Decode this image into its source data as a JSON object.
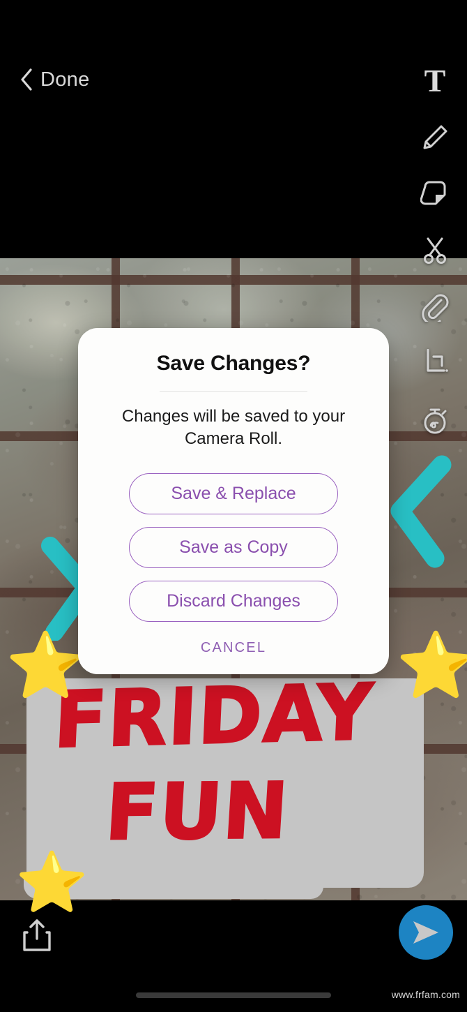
{
  "top_bar": {
    "done_label": "Done",
    "back_icon": "chevron-left-icon"
  },
  "toolbar": {
    "items": [
      {
        "icon": "text-icon",
        "label": "T"
      },
      {
        "icon": "pencil-icon",
        "label": ""
      },
      {
        "icon": "sticker-icon",
        "label": ""
      },
      {
        "icon": "scissors-icon",
        "label": ""
      },
      {
        "icon": "paperclip-icon",
        "label": ""
      },
      {
        "icon": "crop-icon",
        "label": ""
      },
      {
        "icon": "timer-icon",
        "label": ""
      }
    ]
  },
  "dialog": {
    "title": "Save Changes?",
    "message": "Changes will be saved to your Camera Roll.",
    "buttons": [
      {
        "label": "Save & Replace",
        "name": "save-and-replace"
      },
      {
        "label": "Save as Copy",
        "name": "save-as-copy"
      },
      {
        "label": "Discard Changes",
        "name": "discard-changes"
      }
    ],
    "cancel_label": "CANCEL",
    "accent_color": "#8a4fae",
    "border_color": "#9a62c0",
    "background": "#fdfdfc"
  },
  "canvas": {
    "drawing_text_line1": "FRIDAY",
    "drawing_text_line2": "FUN",
    "drawing_color": "#cc1122",
    "highlight_color": "#c5c5c5",
    "chevron_color": "#28bfc4",
    "star_glyph": "⭐",
    "stars_count": 3
  },
  "bottom_bar": {
    "share_icon": "share-upload-icon",
    "send_icon": "send-arrow-icon",
    "send_button_color": "#1d84c3",
    "home_indicator": "home-indicator"
  },
  "watermark": {
    "text": "www.frfam.com"
  }
}
